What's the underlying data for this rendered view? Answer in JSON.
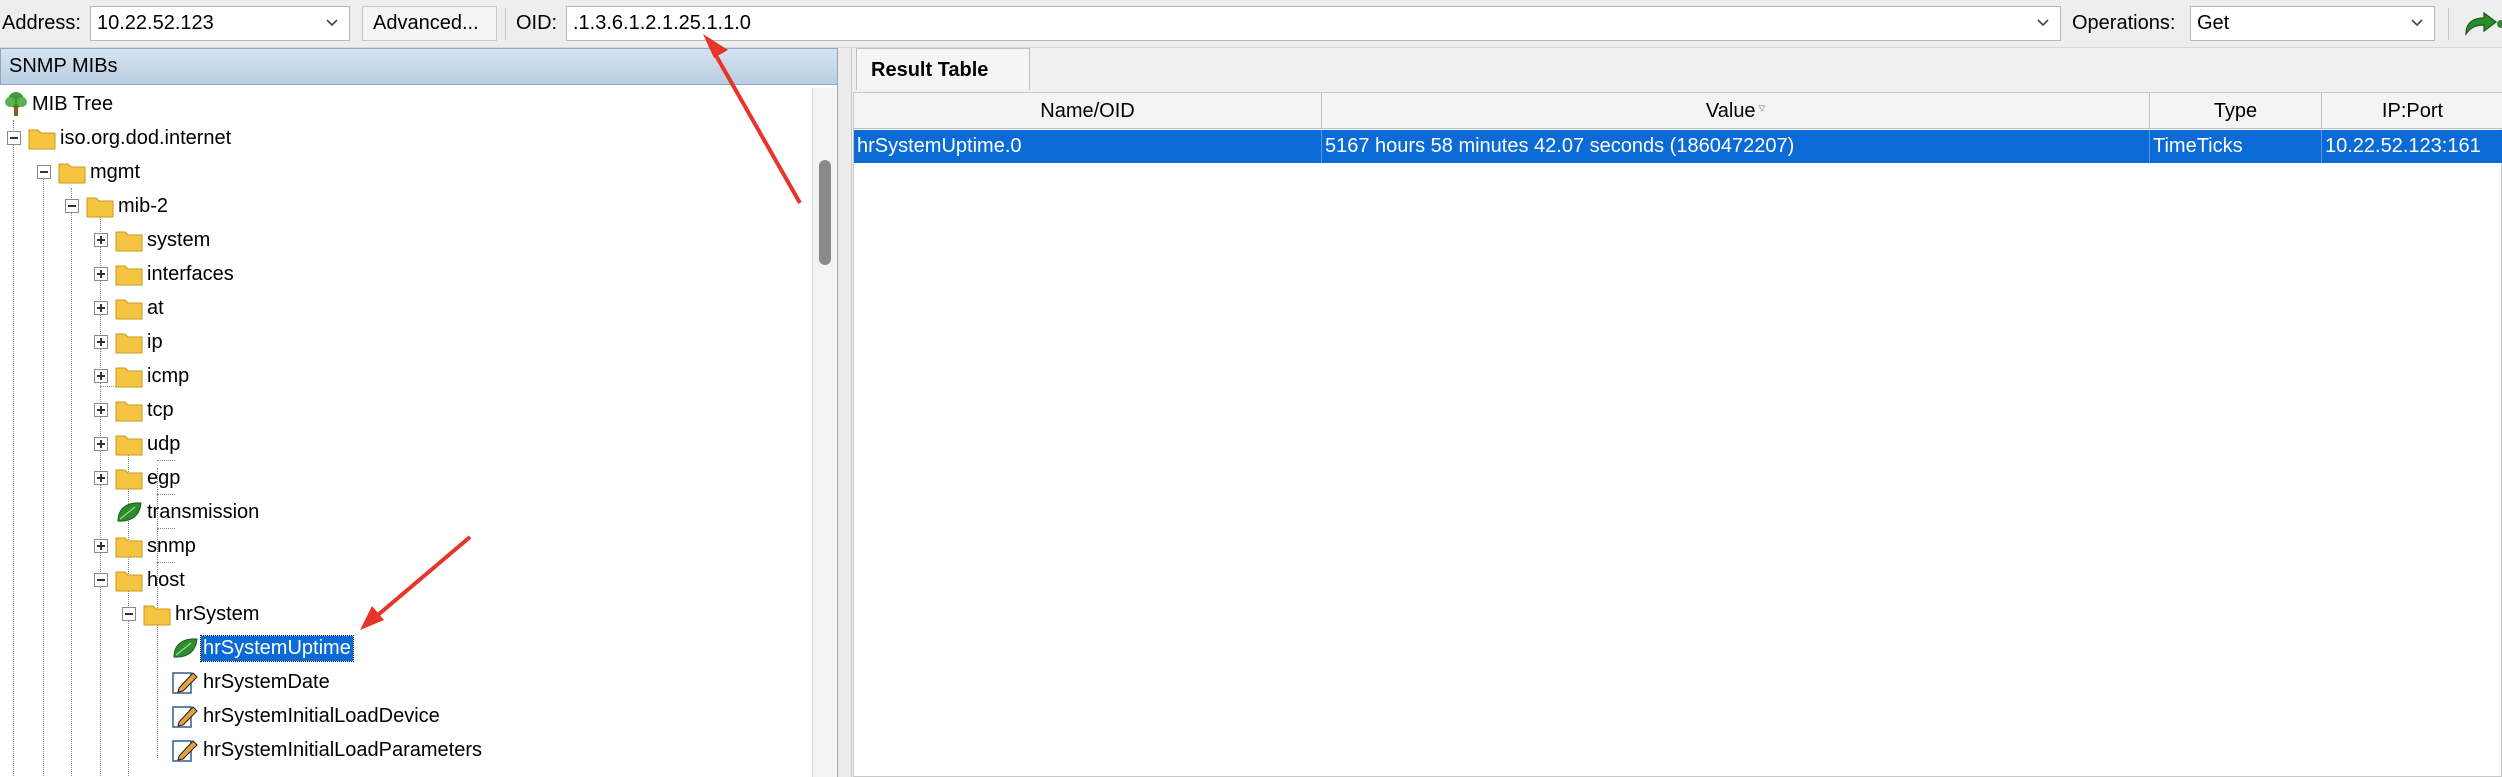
{
  "toolbar": {
    "address_label": "Address:",
    "address_value": "10.22.52.123",
    "advanced_label": "Advanced...",
    "oid_label": "OID:",
    "oid_value": ".1.3.6.1.2.1.25.1.1.0",
    "operations_label": "Operations:",
    "operations_value": "Get",
    "go_icon": "go-arrow-icon"
  },
  "mib_panel": {
    "header": "SNMP MIBs",
    "tree": [
      {
        "label": "MIB Tree",
        "icon": "tree-icon"
      },
      {
        "label": "iso.org.dod.internet",
        "icon": "folder-icon"
      },
      {
        "label": "mgmt",
        "icon": "folder-icon"
      },
      {
        "label": "mib-2",
        "icon": "folder-icon"
      },
      {
        "label": "system",
        "icon": "folder-icon"
      },
      {
        "label": "interfaces",
        "icon": "folder-icon"
      },
      {
        "label": "at",
        "icon": "folder-icon"
      },
      {
        "label": "ip",
        "icon": "folder-icon"
      },
      {
        "label": "icmp",
        "icon": "folder-icon"
      },
      {
        "label": "tcp",
        "icon": "folder-icon"
      },
      {
        "label": "udp",
        "icon": "folder-icon"
      },
      {
        "label": "egp",
        "icon": "folder-icon"
      },
      {
        "label": "transmission",
        "icon": "leaf-icon"
      },
      {
        "label": "snmp",
        "icon": "folder-icon"
      },
      {
        "label": "host",
        "icon": "folder-icon"
      },
      {
        "label": "hrSystem",
        "icon": "folder-icon"
      },
      {
        "label": "hrSystemUptime",
        "icon": "leaf-icon"
      },
      {
        "label": "hrSystemDate",
        "icon": "writable-icon"
      },
      {
        "label": "hrSystemInitialLoadDevice",
        "icon": "writable-icon"
      },
      {
        "label": "hrSystemInitialLoadParameters",
        "icon": "writable-icon"
      }
    ]
  },
  "result": {
    "tab_label": "Result Table",
    "columns": [
      "Name/OID",
      "Value",
      "Type",
      "IP:Port"
    ],
    "rows": [
      {
        "name": "hrSystemUptime.0",
        "value": "5167 hours 58 minutes 42.07 seconds (1860472207)",
        "type": "TimeTicks",
        "ipport": "10.22.52.123:161"
      }
    ]
  },
  "colors": {
    "selection": "#0a6ad6",
    "annotation_arrow": "#e8352a",
    "folder": "#f5c542",
    "leaf": "#2e8b2e"
  }
}
